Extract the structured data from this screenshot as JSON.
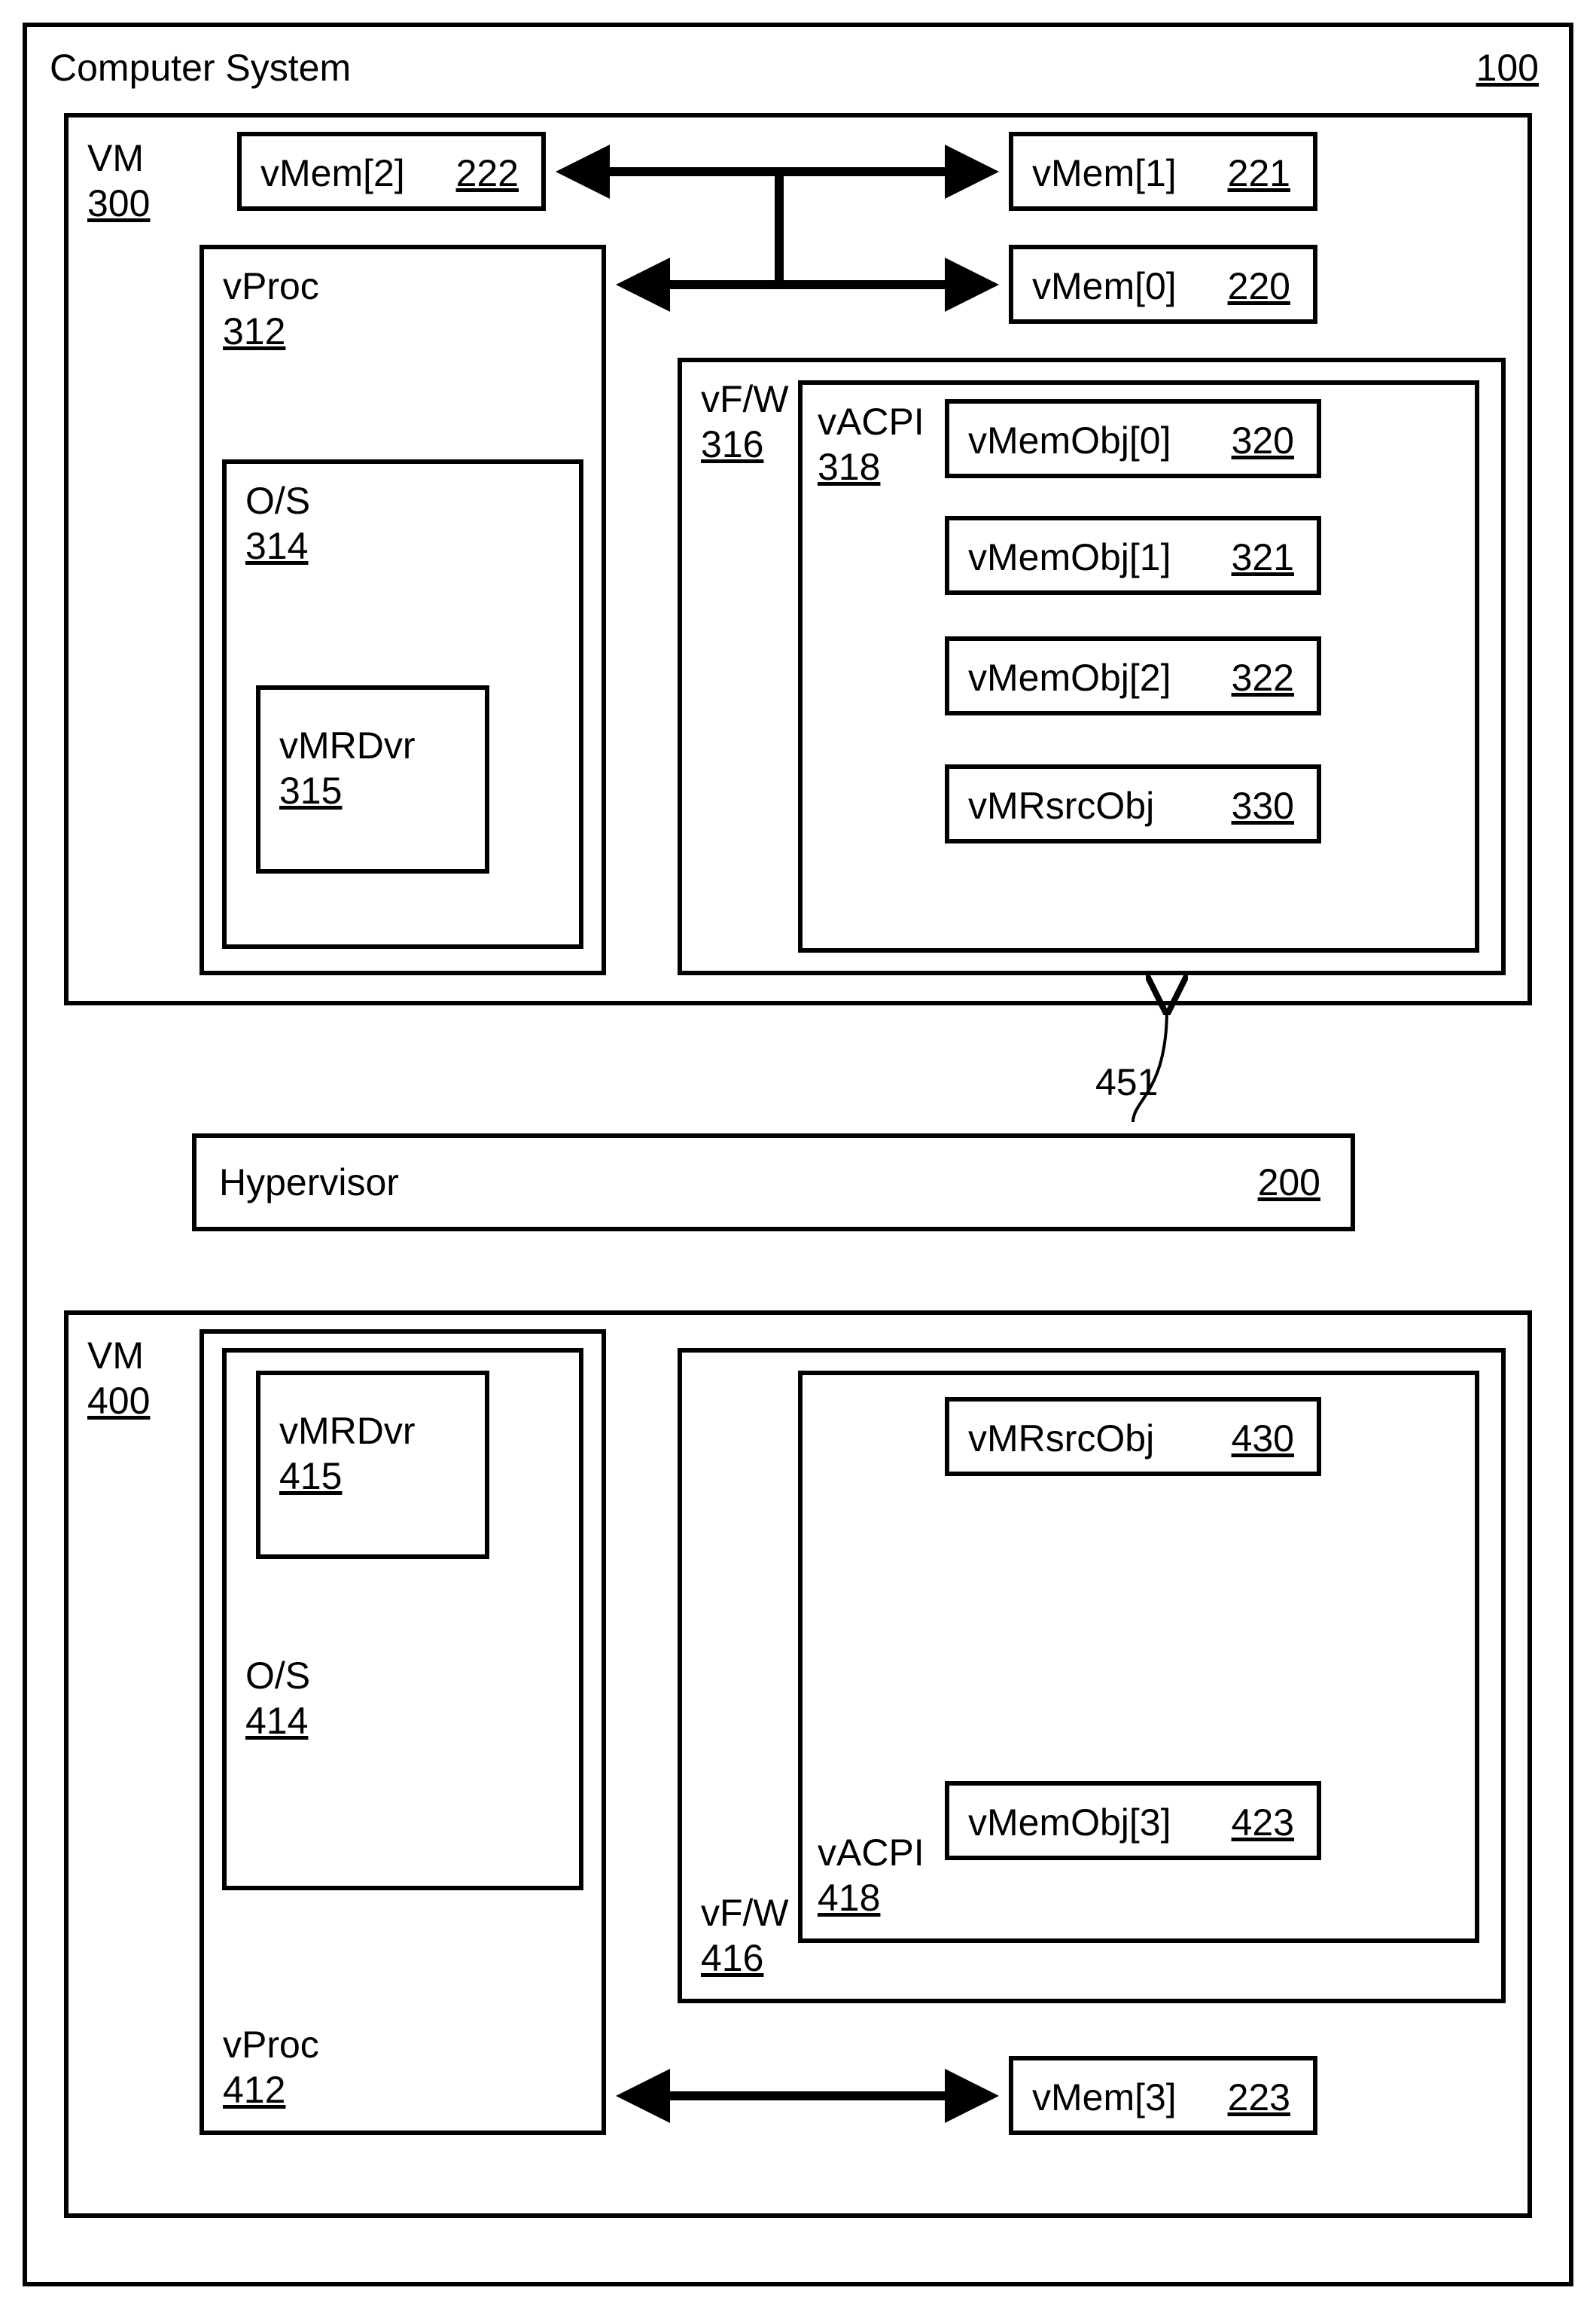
{
  "computerSystem": {
    "label": "Computer System",
    "num": "100"
  },
  "vm300": {
    "label": "VM",
    "num": "300"
  },
  "vmem2": {
    "label": "vMem[2]",
    "num": "222"
  },
  "vmem1": {
    "label": "vMem[1]",
    "num": "221"
  },
  "vmem0": {
    "label": "vMem[0]",
    "num": "220"
  },
  "vproc312": {
    "label": "vProc",
    "num": "312"
  },
  "os314": {
    "label": "O/S",
    "num": "314"
  },
  "vmrdvr315": {
    "label": "vMRDvr",
    "num": "315"
  },
  "vfw316": {
    "label": "vF/W",
    "num": "316"
  },
  "vacpi318": {
    "label": "vACPI",
    "num": "318"
  },
  "vmemobj0": {
    "label": "vMemObj[0]",
    "num": "320"
  },
  "vmemobj1": {
    "label": "vMemObj[1]",
    "num": "321"
  },
  "vmemobj2": {
    "label": "vMemObj[2]",
    "num": "322"
  },
  "vmrsrcobj330": {
    "label": "vMRsrcObj",
    "num": "330"
  },
  "hypervisor": {
    "label": "Hypervisor",
    "num": "200"
  },
  "arrow451": {
    "num": "451"
  },
  "vm400": {
    "label": "VM",
    "num": "400"
  },
  "vproc412": {
    "label": "vProc",
    "num": "412"
  },
  "os414": {
    "label": "O/S",
    "num": "414"
  },
  "vmrdvr415": {
    "label": "vMRDvr",
    "num": "415"
  },
  "vfw416": {
    "label": "vF/W",
    "num": "416"
  },
  "vacpi418": {
    "label": "vACPI",
    "num": "418"
  },
  "vmrsrcobj430": {
    "label": "vMRsrcObj",
    "num": "430"
  },
  "vmemobj3": {
    "label": "vMemObj[3]",
    "num": "423"
  },
  "vmem3": {
    "label": "vMem[3]",
    "num": "223"
  }
}
